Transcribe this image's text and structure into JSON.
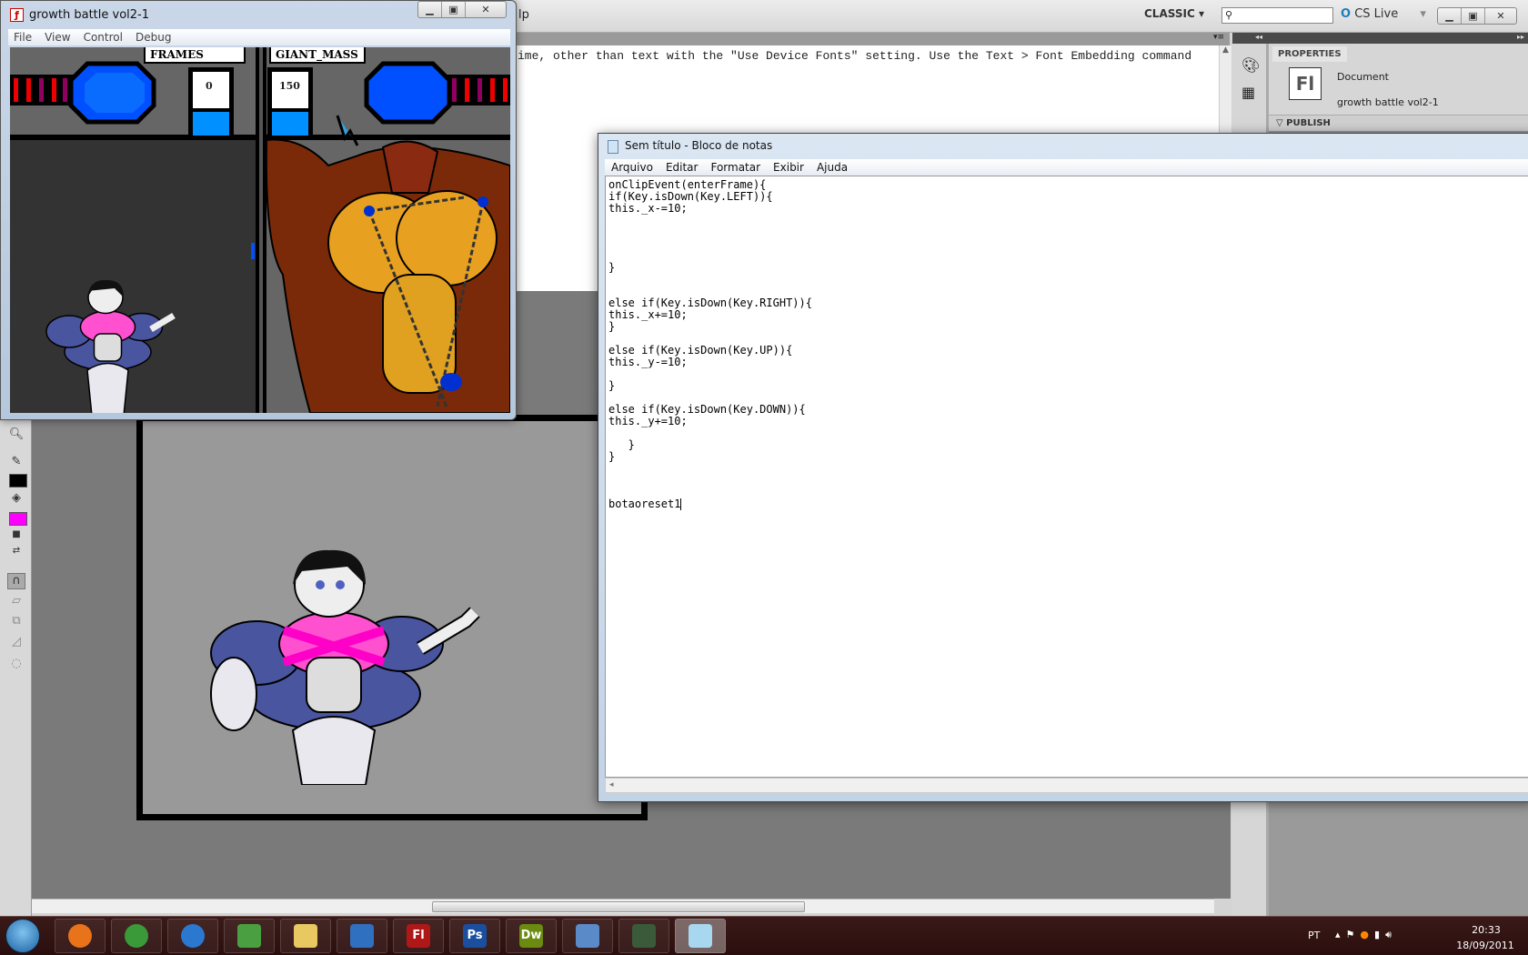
{
  "ide": {
    "menu_partial": "lp",
    "workspace": "CLASSIC",
    "search_placeholder": "",
    "cs_live": "CS Live",
    "output_text": "ime, other than text with the \"Use Device Fonts\" setting. Use the Text > Font Embedding command",
    "properties": {
      "tab": "PROPERTIES",
      "doc_icon": "Fl",
      "doc_label": "Document",
      "doc_name": "growth battle vol2-1",
      "publish_section": "PUBLISH"
    },
    "tools": [
      "zoom-icon",
      "pencil-icon",
      "stroke-color",
      "paint-bucket-icon",
      "fill-color",
      "default-colors-icon",
      "swap-colors-icon",
      "snap-magnet-icon",
      "straighten-icon",
      "smooth-icon",
      "transform-icon",
      "lasso-icon"
    ],
    "stroke_color": "#000000",
    "fill_color": "#ff00ff"
  },
  "flash_player": {
    "title": "growth battle vol2-1",
    "menu": [
      "File",
      "View",
      "Control",
      "Debug"
    ],
    "hud": {
      "frames_label": "FRAMES",
      "frames_value": "0",
      "mass_label": "GIANT_MASS",
      "mass_value": "150"
    }
  },
  "notepad": {
    "title": "Sem título - Bloco de notas",
    "menu": [
      "Arquivo",
      "Editar",
      "Formatar",
      "Exibir",
      "Ajuda"
    ],
    "lines": [
      "onClipEvent(enterFrame){",
      "if(Key.isDown(Key.LEFT)){",
      "this._x-=10;",
      "",
      "",
      "",
      "",
      "}",
      "",
      "",
      "else if(Key.isDown(Key.RIGHT)){",
      "this._x+=10;",
      "}",
      "",
      "else if(Key.isDown(Key.UP)){",
      "this._y-=10;",
      "",
      "}",
      "",
      "else if(Key.isDown(Key.DOWN)){",
      "this._y+=10;",
      "",
      "   }",
      "}",
      "",
      "",
      "",
      "botaoreset1"
    ]
  },
  "taskbar": {
    "apps": [
      "firefox",
      "chrome",
      "internet-explorer",
      "messenger",
      "windows-explorer",
      "media-player",
      "flash",
      "photoshop",
      "dreamweaver",
      "remote-desktop",
      "task-manager",
      "notepad"
    ],
    "app_labels": {
      "flash": "Fl",
      "photoshop": "Ps",
      "dreamweaver": "Dw"
    },
    "language": "PT",
    "time": "20:33",
    "date": "18/09/2011"
  }
}
